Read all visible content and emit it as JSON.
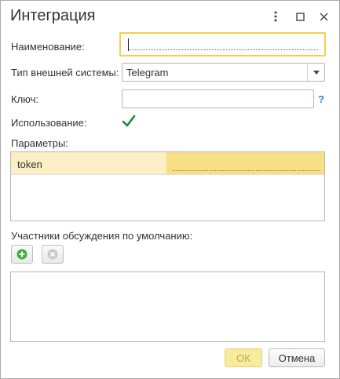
{
  "window": {
    "title": "Интеграция",
    "menu_icon": "more-vertical-icon",
    "maximize_icon": "maximize-icon",
    "close_icon": "close-icon"
  },
  "form": {
    "name_label": "Наименование:",
    "name_value": "",
    "system_type_label": "Тип внешней системы:",
    "system_type_value": "Telegram",
    "key_label": "Ключ:",
    "key_value": "",
    "key_help": "?",
    "usage_label": "Использование:",
    "usage_checked": true,
    "params_label": "Параметры:",
    "params_rows": [
      {
        "name": "token",
        "value": ""
      }
    ],
    "participants_label": "Участники обсуждения по умолчанию:",
    "add_icon": "add-icon",
    "remove_icon": "remove-icon"
  },
  "buttons": {
    "ok": "ОК",
    "cancel": "Отмена"
  },
  "colors": {
    "focus_border": "#f2cf4d",
    "selected_row": "#f8de85",
    "checkmark": "#1a8a3a",
    "add_green": "#3fae3f",
    "help_blue": "#3a7fd5"
  }
}
